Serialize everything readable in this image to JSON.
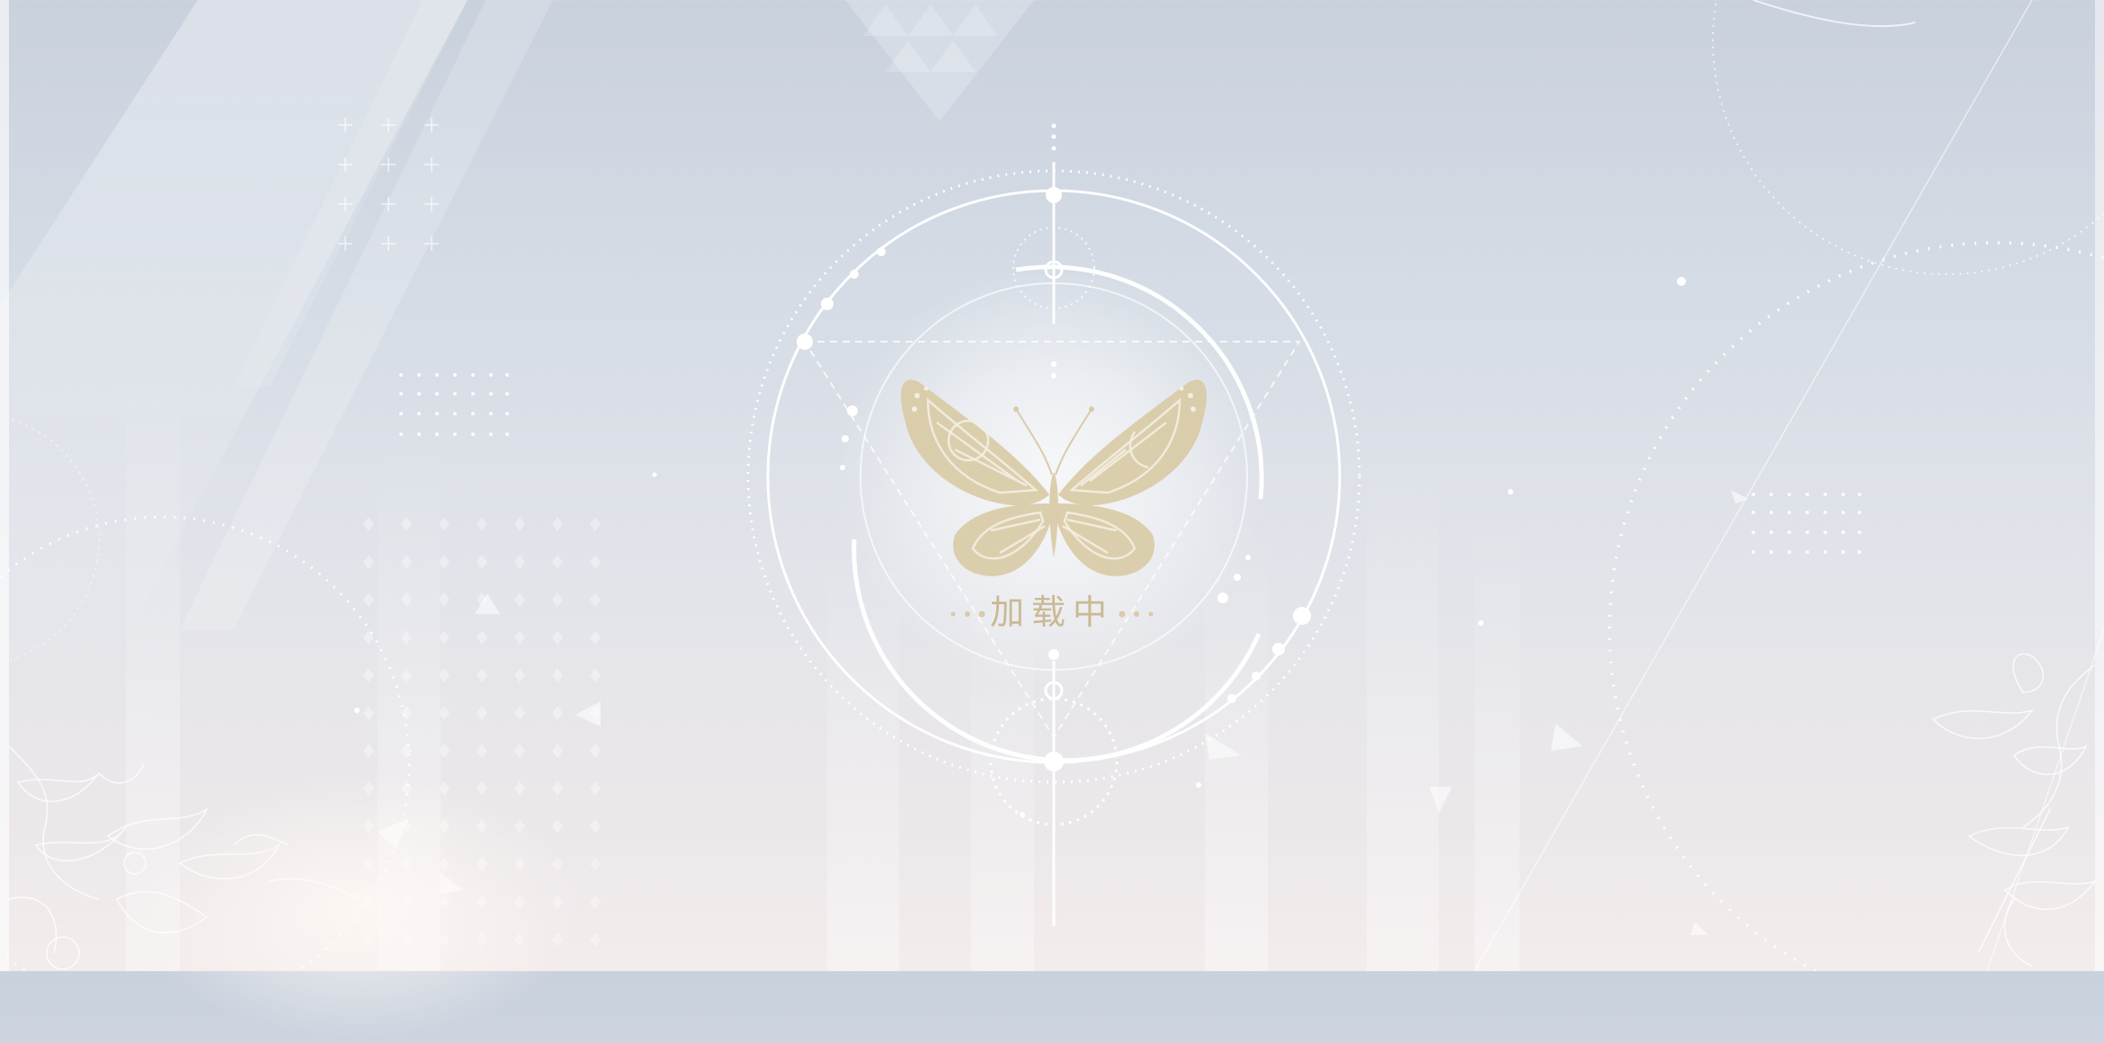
{
  "loading": {
    "label": "加载中"
  },
  "icons": {
    "center_emblem": "butterfly-icon"
  },
  "colors": {
    "accent_gold": "#c9b994",
    "ring_white": "#ffffff",
    "background_top": "#c9d1dd",
    "background_bottom": "#f3ecec"
  }
}
